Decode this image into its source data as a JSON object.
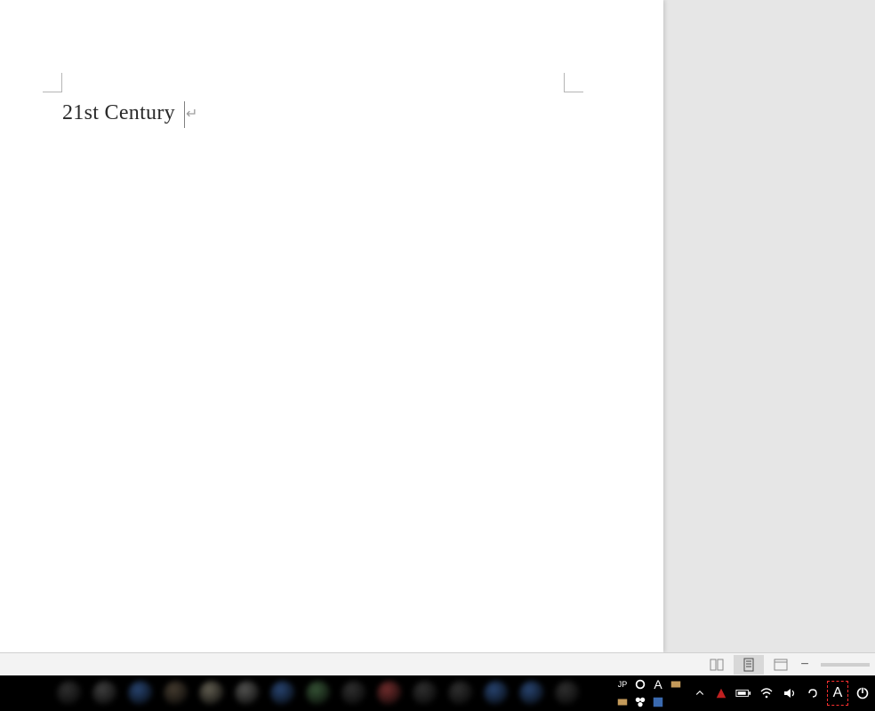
{
  "document": {
    "text": "21st Century",
    "paragraph_mark_glyph": "↵"
  },
  "statusbar": {
    "view_read_label": "Read Mode",
    "view_print_label": "Print Layout",
    "view_web_label": "Web Layout",
    "zoom_minus": "−"
  },
  "taskbar": {
    "app_blobs_colors": [
      "#333333",
      "#444444",
      "#2b4a7a",
      "#4a4033",
      "#6a6658",
      "#5a5a58",
      "#2b4a7a",
      "#3a5a3a",
      "#333333",
      "#7a3030",
      "#333333",
      "#333333",
      "#2b4a7a",
      "#2b4a7a",
      "#333333"
    ],
    "tray": {
      "lang": "JP",
      "ime_main": "A",
      "chevron_up": "˄",
      "battery": "bat",
      "wifi": "wifi",
      "volume": "vol",
      "extra": "∂",
      "ime_highlighted": "A",
      "power": "◯"
    }
  },
  "colors": {
    "page_bg": "#ffffff",
    "app_bg": "#e6e6e6",
    "taskbar_bg": "#000000",
    "highlight_border": "#ff3030"
  }
}
